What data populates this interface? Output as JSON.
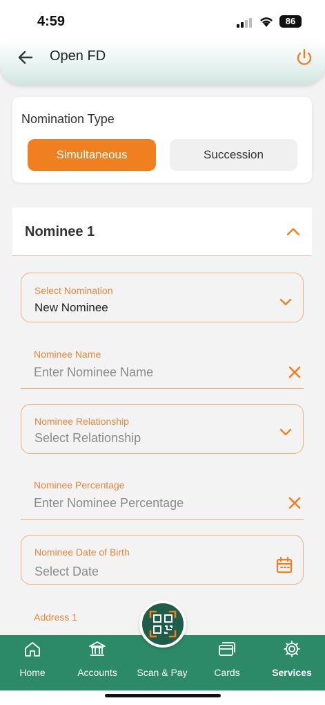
{
  "status_bar": {
    "time": "4:59",
    "battery": "86"
  },
  "header": {
    "title": "Open FD"
  },
  "nomination_type": {
    "label": "Nomination Type",
    "options": [
      "Simultaneous",
      "Succession"
    ],
    "selected": "Simultaneous"
  },
  "nominee_section": {
    "title": "Nominee 1",
    "fields": {
      "select_nomination": {
        "label": "Select Nomination",
        "value": "New Nominee"
      },
      "nominee_name": {
        "label": "Nominee Name",
        "placeholder": "Enter Nominee Name"
      },
      "relationship": {
        "label": "Nominee Relationship",
        "placeholder": "Select Relationship"
      },
      "percentage": {
        "label": "Nominee Percentage",
        "placeholder": "Enter Nominee Percentage"
      },
      "dob": {
        "label": "Nominee Date of Birth",
        "placeholder": "Select Date"
      },
      "address1": {
        "label": "Address 1"
      }
    }
  },
  "bottom_nav": {
    "items": [
      {
        "label": "Home",
        "icon": "home-icon"
      },
      {
        "label": "Accounts",
        "icon": "bank-icon"
      },
      {
        "label": "Scan & Pay",
        "icon": "qr-icon"
      },
      {
        "label": "Cards",
        "icon": "cards-icon"
      },
      {
        "label": "Services",
        "icon": "gear-icon"
      }
    ],
    "active": "Services"
  },
  "colors": {
    "accent": "#f07f20",
    "nav_green": "#2c8a68",
    "scan_green": "#1e5d49"
  }
}
